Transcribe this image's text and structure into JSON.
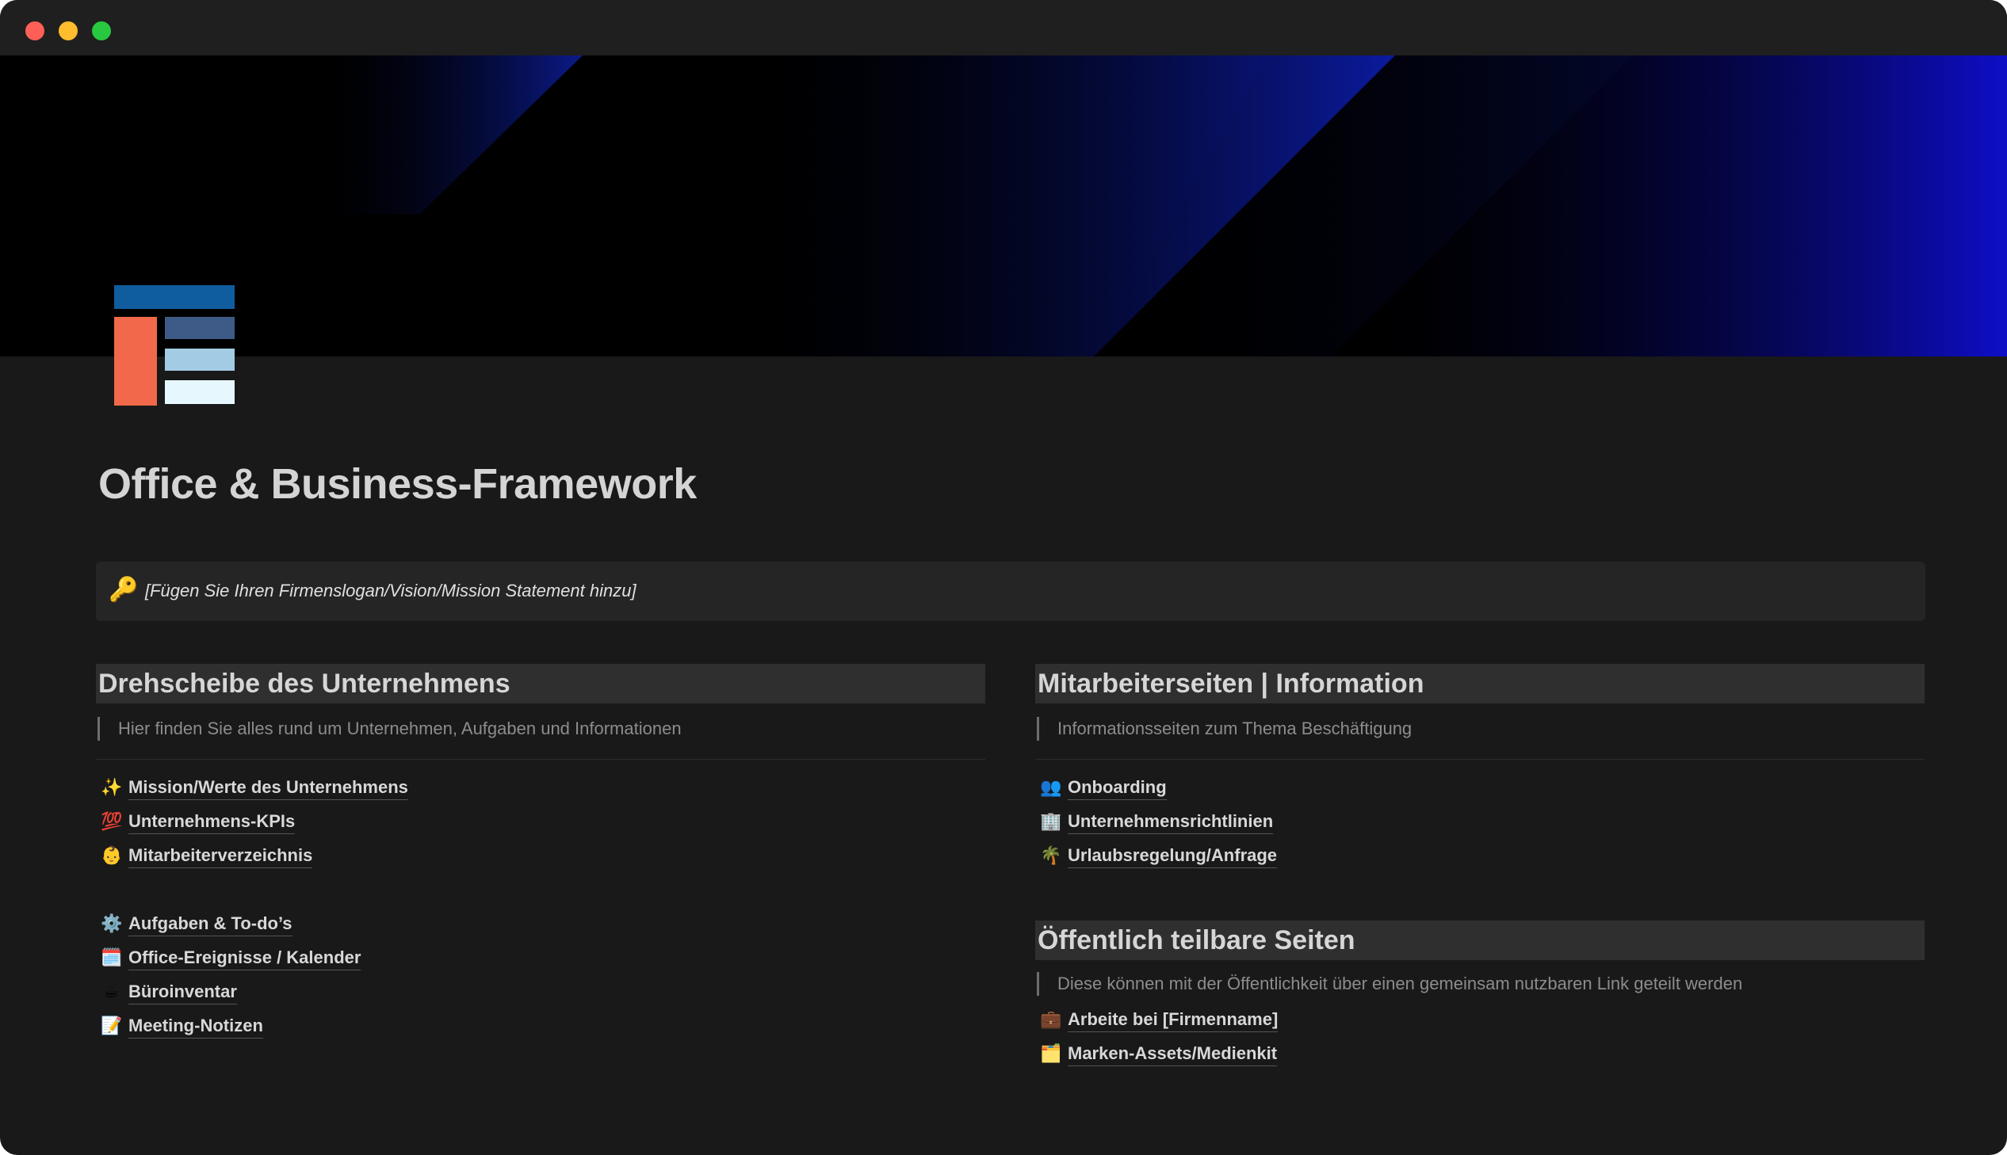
{
  "window": {
    "controls": [
      "close",
      "minimize",
      "zoom"
    ]
  },
  "page": {
    "title": "Office & Business-Framework",
    "icon": "framework-logo-icon"
  },
  "callout": {
    "icon": "🔑",
    "text": "[Fügen Sie Ihren Firmenslogan/Vision/Mission Statement hinzu]"
  },
  "left_section": {
    "heading": "Drehscheibe des Unternehmens",
    "description": "Hier finden Sie alles rund um Unternehmen, Aufgaben und Informationen",
    "group1": [
      {
        "icon": "✨",
        "label": "Mission/Werte des Unternehmens"
      },
      {
        "icon": "💯",
        "label": "Unternehmens-KPIs"
      },
      {
        "icon": "👶",
        "label": "Mitarbeiterverzeichnis"
      }
    ],
    "group2": [
      {
        "icon": "⚙️",
        "label": "Aufgaben & To-do’s"
      },
      {
        "icon": "🗓️",
        "label": "Office-Ereignisse / Kalender"
      },
      {
        "icon": "☕",
        "label": "Büroinventar"
      },
      {
        "icon": "📝",
        "label": "Meeting-Notizen"
      }
    ]
  },
  "right_section": {
    "heading": "Mitarbeiterseiten | Information",
    "description": "Informationsseiten zum Thema Beschäftigung",
    "items": [
      {
        "icon": "👥",
        "label": "Onboarding"
      },
      {
        "icon": "🏢",
        "label": "Unternehmensrichtlinien"
      },
      {
        "icon": "🌴",
        "label": "Urlaubsregelung/Anfrage"
      }
    ]
  },
  "public_section": {
    "heading": "Öffentlich teilbare Seiten",
    "description": "Diese können mit der Öffentlichkeit über einen gemeinsam nutzbaren Link geteilt werden",
    "items": [
      {
        "icon": "💼",
        "label": "Arbeite bei [Firmenname]"
      },
      {
        "icon": "🗂️",
        "label": "Marken-Assets/Medienkit"
      }
    ]
  },
  "colors": {
    "background": "#191919",
    "titlebar": "#1f1f1f",
    "heading_bg": "#2f2f2f",
    "callout_bg": "#252525",
    "cover_accent": "#0a0ab4"
  }
}
